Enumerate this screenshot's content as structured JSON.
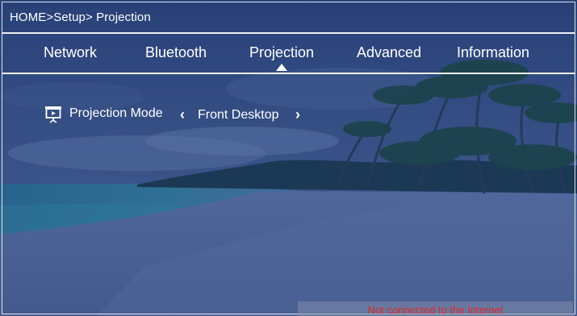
{
  "breadcrumb": "HOME>Setup> Projection",
  "tabs": [
    {
      "label": "Network",
      "selected": false
    },
    {
      "label": "Bluetooth",
      "selected": false
    },
    {
      "label": "Projection",
      "selected": true
    },
    {
      "label": "Advanced",
      "selected": false
    },
    {
      "label": "Information",
      "selected": false
    }
  ],
  "setting": {
    "icon": "projector-icon",
    "label": "Projection Mode",
    "value": "Front Desktop",
    "prev_icon": "chevron-left-icon",
    "next_icon": "chevron-right-icon"
  },
  "status": {
    "text": "Not connected to the Internet",
    "color": "#e02828"
  },
  "colors": {
    "overlay": "#2b3f68",
    "text": "#ffffff"
  }
}
